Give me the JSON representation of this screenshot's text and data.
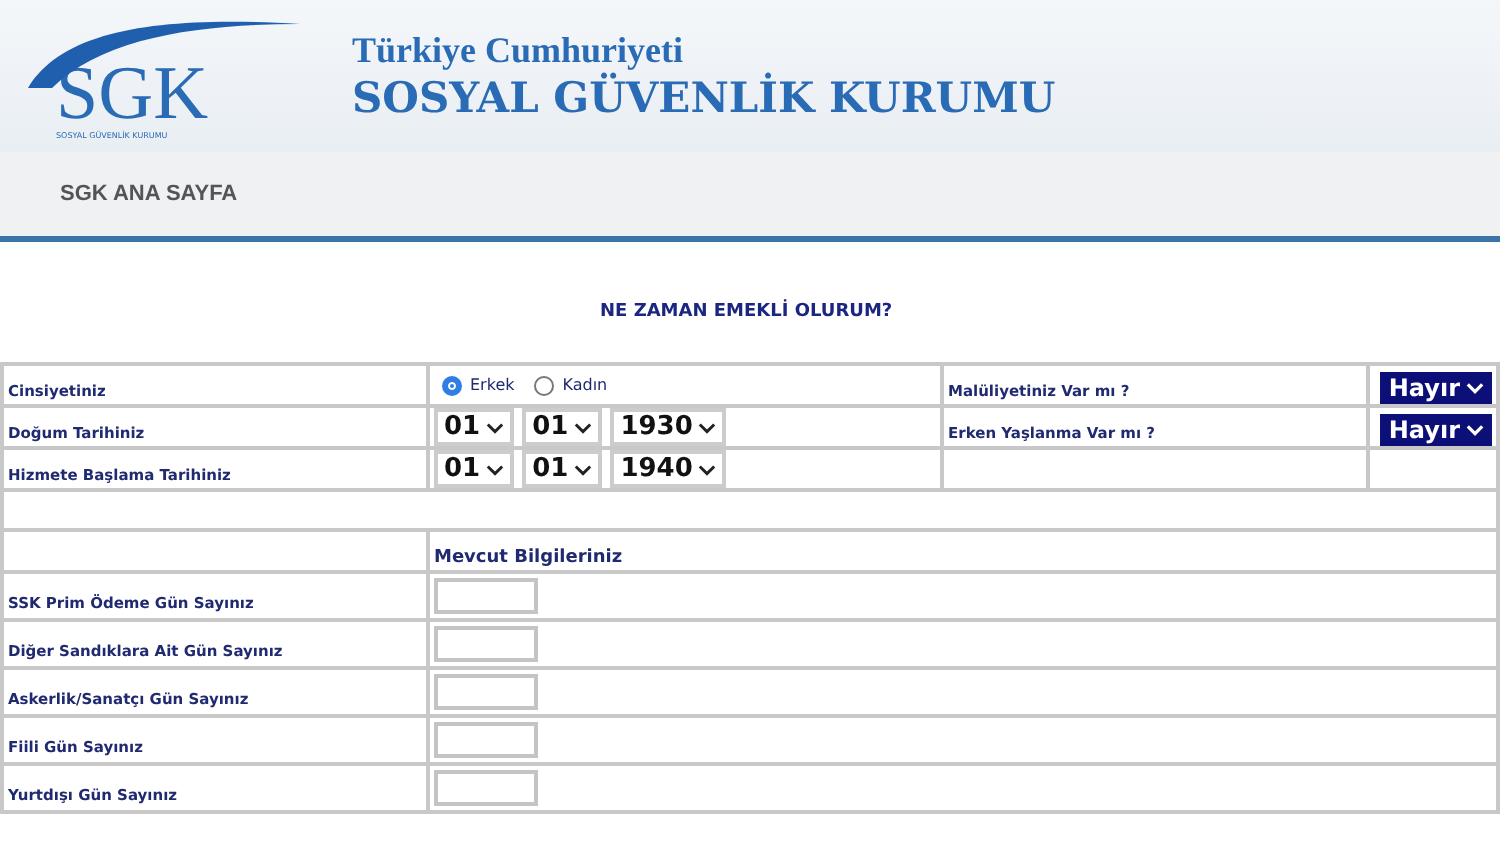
{
  "header": {
    "logo_text": "SGK",
    "logo_subtext": "SOSYAL GÜVENLİK KURUMU",
    "title_small": "Türkiye Cumhuriyeti",
    "title_large": "SOSYAL GÜVENLİK KURUMU"
  },
  "nav": [
    {
      "label": "SGK ANA SAYFA"
    }
  ],
  "form": {
    "title": "NE ZAMAN EMEKLİ OLURUM?",
    "gender": {
      "label": "Cinsiyetiniz",
      "options": [
        {
          "label": "Erkek",
          "selected": true
        },
        {
          "label": "Kadın",
          "selected": false
        }
      ]
    },
    "dates": [
      {
        "label": "Doğum Tarihiniz",
        "day": "01",
        "month": "01",
        "year": "1930"
      },
      {
        "label": "Hizmete Başlama Tarihiniz",
        "day": "01",
        "month": "01",
        "year": "1940"
      }
    ],
    "questions": [
      {
        "label": "Malüliyetiniz Var mı ?",
        "value": "Hayır"
      },
      {
        "label": "Erken Yaşlanma Var mı ?",
        "value": "Hayır"
      }
    ],
    "section_title": "Mevcut  Bilgileriniz",
    "day_fields": [
      {
        "label": "SSK Prim Ödeme Gün Sayınız"
      },
      {
        "label": "Diğer Sandıklara Ait Gün Sayınız"
      },
      {
        "label": "Askerlik/Sanatçı Gün Sayınız"
      },
      {
        "label": "Fiili Gün Sayınız"
      },
      {
        "label": "Yurtdışı Gün Sayınız"
      }
    ]
  }
}
